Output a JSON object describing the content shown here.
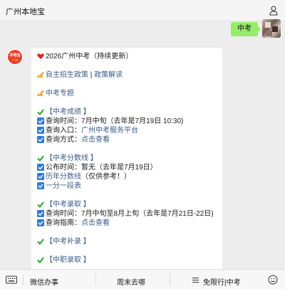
{
  "header": {
    "title": "广州本地宝"
  },
  "user_message": {
    "text": "中考"
  },
  "bot_avatar": {
    "logo_line1": "本地宝",
    "logo_line2": "广州"
  },
  "bot_message": {
    "title": "2026广州中考（持续更新）",
    "policy": {
      "link1": "自主招生政策",
      "divider": "|",
      "link2": "政策解读"
    },
    "special": "中考专题",
    "scores": {
      "heading": "【中考成绩 】",
      "time_label": "查询时间：",
      "time_value": "7月中旬（去年是7月19日 10:30)",
      "entry_label": "查询入口：",
      "entry_link": "广州中考服务平台",
      "method_label": "查询方式：",
      "method_link": "点击查看"
    },
    "cutoff": {
      "heading": "【中考分数线 】",
      "publish_label": "公布时间：",
      "publish_value": "暂无（去年是7月19日）",
      "history_link": "历年分数线",
      "history_note": "（仅供参考！）",
      "rank_link": "一分一段表"
    },
    "admission": {
      "heading": "【中考录取 】",
      "time_label": "查询时间：",
      "time_value": "7月中旬至8月上旬（去年是7月21日-22日)",
      "guide_label": "查询指南：",
      "guide_link": "点击查看"
    },
    "supplement": {
      "heading": "【中考补录 】"
    },
    "vocational": {
      "heading": "【中职录取 】"
    }
  },
  "bottom_bar": {
    "items": [
      "微信办事",
      "周末去哪",
      "免限行|中考"
    ],
    "icons": [
      "keyboard-icon",
      "menu-icon",
      "smile-icon"
    ]
  },
  "colors": {
    "bubble_green": "#95ec69",
    "link_blue": "#3a5b8a",
    "check_green": "#2aa52a",
    "box_blue": "#2c7be5"
  }
}
